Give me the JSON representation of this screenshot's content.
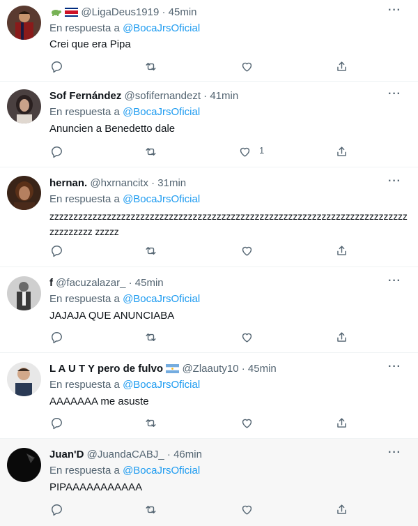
{
  "reply_prefix": "En respuesta a",
  "reply_to": "@BocaJrsOficial",
  "more_glyph": "···",
  "colors": {
    "accent": "#1d9bf0",
    "muted": "#536471",
    "text": "#0f1419",
    "highlight_bg": "#f7f7f7"
  },
  "tweets": [
    {
      "name": "",
      "name_decor": "turtle-emoji + costa-rica-flag",
      "handle": "@LigaDeus1919",
      "time": "45min",
      "text": "Crei que era Pipa",
      "likes": ""
    },
    {
      "name": "Sof Fernández",
      "handle": "@sofifernandezt",
      "time": "41min",
      "text": "Anuncien a Benedetto dale",
      "likes": "1"
    },
    {
      "name": "hernan.",
      "handle": "@hxrnancitx",
      "time": "31min",
      "text": "zzzzzzzzzzzzzzzzzzzzzzzzzzzzzzzzzzzzzzzzzzzzzzzzzzzzzzzzzzzzzzzzzzzzzzzzzzzzzzzzzzzz zzzzz",
      "likes": ""
    },
    {
      "name": "f",
      "handle": "@facuzalazar_",
      "time": "45min",
      "text": "JAJAJA QUE ANUNCIABA",
      "likes": ""
    },
    {
      "name": "L A U T Y pero de fulvo",
      "name_decor": "argentina-flag",
      "handle": "@Zlaauty10",
      "time": "45min",
      "text": "AAAAAAA me asuste",
      "likes": ""
    },
    {
      "name": "Juan'D",
      "handle": "@JuandaCABJ_",
      "time": "46min",
      "text": "PIPAAAAAAAAAAA",
      "likes": ""
    }
  ]
}
